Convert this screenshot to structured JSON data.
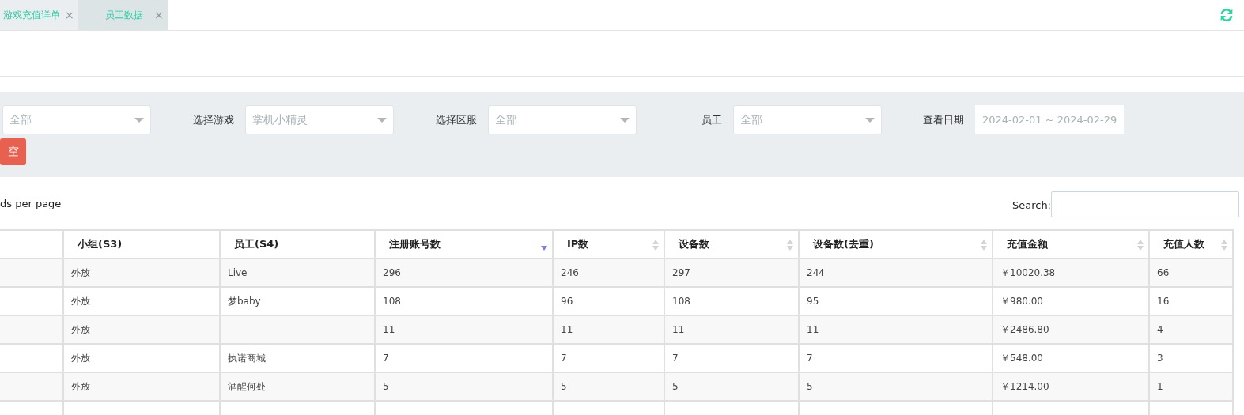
{
  "tabs": [
    {
      "label": "游戏充值详单",
      "close": "×",
      "selected": false
    },
    {
      "label": "员工数据",
      "close": "×",
      "selected": true
    }
  ],
  "filters": [
    {
      "kind": "select",
      "value": "全部"
    },
    {
      "kind": "select",
      "label": "选择游戏",
      "value": "掌机小精灵"
    },
    {
      "kind": "select",
      "label": "选择区服",
      "value": "全部"
    },
    {
      "kind": "select",
      "label": "员工",
      "value": "全部"
    },
    {
      "kind": "date",
      "label": "查看日期",
      "placeholder": "2024-02-01 ~ 2024-02-29"
    }
  ],
  "clear_button": "空",
  "page_length_label": "ds per page",
  "search": {
    "label": "Search:"
  },
  "table": {
    "columns": [
      {
        "sortable": false,
        "sorted": false
      },
      {
        "label": "小组(S3)",
        "sortable": false,
        "sorted": false
      },
      {
        "label": "员工(S4)",
        "sortable": false,
        "sorted": false
      },
      {
        "label": "注册账号数",
        "sortable": true,
        "sorted": true
      },
      {
        "label": "IP数",
        "sortable": true,
        "sorted": false
      },
      {
        "label": "设备数",
        "sortable": true,
        "sorted": false
      },
      {
        "label": "设备数(去重)",
        "sortable": true,
        "sorted": false
      },
      {
        "label": "充值金额",
        "sortable": true,
        "sorted": false
      },
      {
        "label": "充值人数",
        "sortable": true,
        "sorted": false
      }
    ],
    "rows": [
      [
        null,
        "外放",
        "Live",
        "296",
        "246",
        "297",
        "244",
        "￥10020.38",
        "66"
      ],
      [
        null,
        "外放",
        "梦baby",
        "108",
        "96",
        "108",
        "95",
        "￥980.00",
        "16"
      ],
      [
        null,
        "外放",
        null,
        "11",
        "11",
        "11",
        "11",
        "￥2486.80",
        "4"
      ],
      [
        null,
        "外放",
        "执诺商城",
        "7",
        "7",
        "7",
        "7",
        "￥548.00",
        "3"
      ],
      [
        null,
        "外放",
        "酒醒何处",
        "5",
        "5",
        "5",
        "5",
        "￥1214.00",
        "1"
      ],
      [
        null,
        null,
        null,
        null,
        null,
        null,
        null,
        null,
        null
      ]
    ]
  }
}
